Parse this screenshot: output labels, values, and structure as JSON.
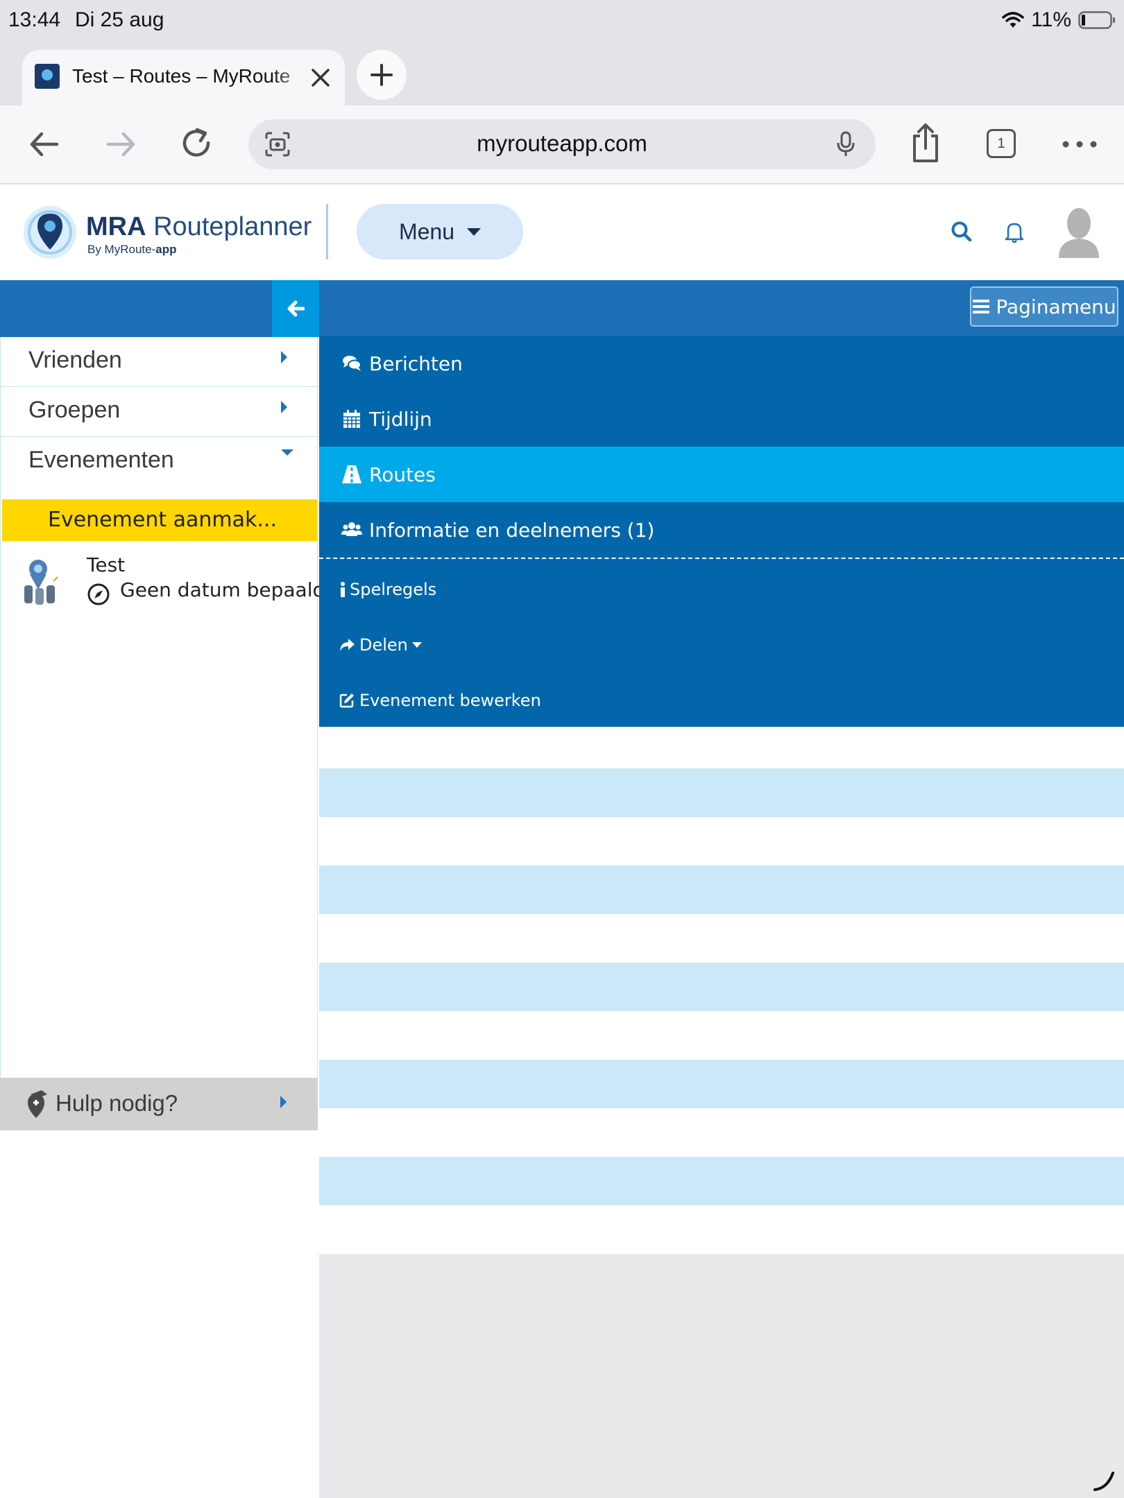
{
  "status_bar": {
    "time": "13:44",
    "date": "Di 25 aug",
    "battery_pct": "11%",
    "icons": [
      "wifi-icon",
      "battery-icon"
    ]
  },
  "browser": {
    "tab": {
      "title": "Test – Routes – MyRoute",
      "favicon": "myroute-favicon"
    },
    "url": "myrouteapp.com",
    "tab_count": "1",
    "icons": [
      "back-icon",
      "forward-icon",
      "reload-icon",
      "camera-scan-icon",
      "microphone-icon",
      "share-icon",
      "tabs-icon",
      "more-icon",
      "new-tab-icon",
      "close-icon"
    ]
  },
  "header": {
    "logo_bold": "MRA",
    "logo_name": "Routeplanner",
    "logo_sub_prefix": "By MyRoute-",
    "logo_sub_bold": "app",
    "menu_label": "Menu",
    "icons": [
      "search-icon",
      "bell-icon",
      "avatar-icon"
    ]
  },
  "sidebar": {
    "items": [
      {
        "label": "Vrienden",
        "state": "collapsed"
      },
      {
        "label": "Groepen",
        "state": "collapsed"
      },
      {
        "label": "Evenementen",
        "state": "expanded"
      }
    ],
    "create_event_label": "Evenement aanmak...",
    "event": {
      "name": "Test",
      "date": "Geen datum bepaald"
    },
    "help_label": "Hulp nodig?"
  },
  "page_menu": {
    "button_label": "Paginamenu",
    "items": [
      {
        "label": "Berichten",
        "icon": "comments-icon",
        "active": false
      },
      {
        "label": "Tijdlijn",
        "icon": "calendar-icon",
        "active": false
      },
      {
        "label": "Routes",
        "icon": "road-icon",
        "active": true
      },
      {
        "label": "Informatie en deelnemers (1)",
        "icon": "users-icon",
        "active": false
      }
    ],
    "secondary_items": [
      {
        "label": "Spelregels",
        "icon": "info-icon"
      },
      {
        "label": "Delen",
        "icon": "share-arrow-icon"
      },
      {
        "label": "Evenement bewerken",
        "icon": "edit-icon"
      }
    ]
  },
  "colors": {
    "brand_dark_blue": "#0366ab",
    "bar_blue": "#1d6fb6",
    "active_blue": "#00a9ea",
    "yellow": "#ffd600",
    "stripe_light": "#cae8f8"
  }
}
